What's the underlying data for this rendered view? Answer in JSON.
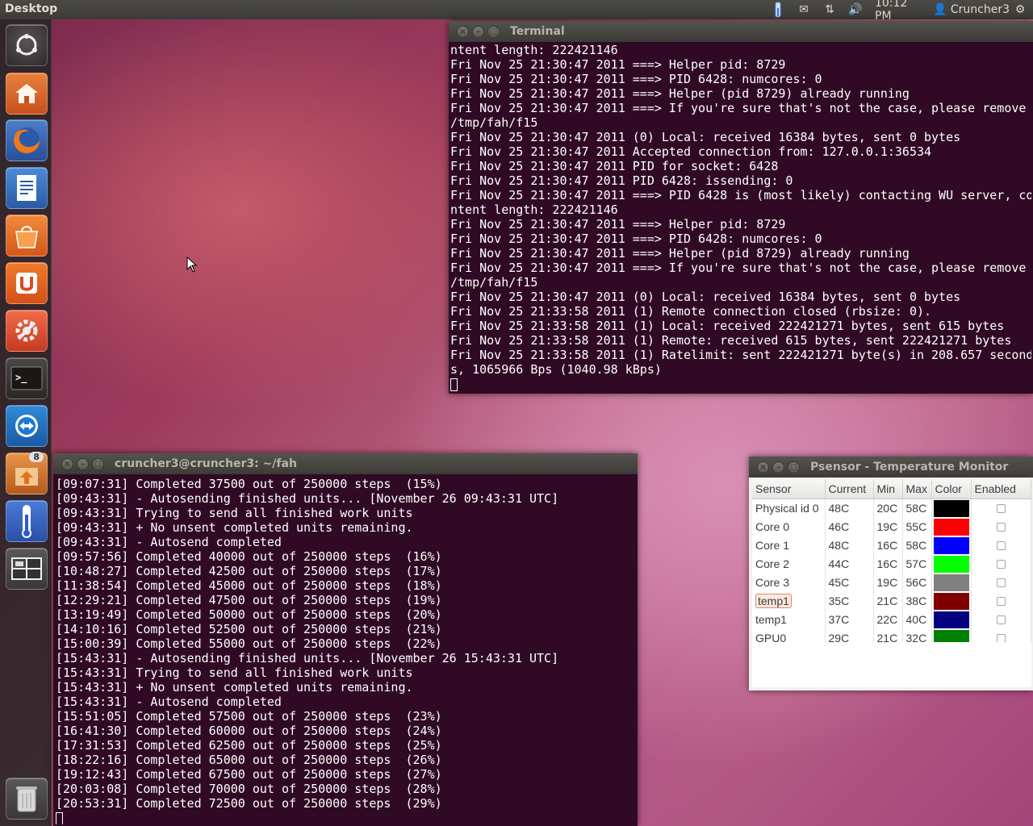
{
  "top_panel": {
    "title": "Desktop",
    "clock": "10:12 PM",
    "user": "Cruncher3"
  },
  "launcher": {
    "items": [
      {
        "name": "dash"
      },
      {
        "name": "home-folder"
      },
      {
        "name": "firefox"
      },
      {
        "name": "libreoffice-writer"
      },
      {
        "name": "ubuntu-software-center"
      },
      {
        "name": "ubuntu-one"
      },
      {
        "name": "system-settings"
      },
      {
        "name": "terminal"
      },
      {
        "name": "teamviewer"
      },
      {
        "name": "archive-manager",
        "badge": "8"
      },
      {
        "name": "psensor"
      },
      {
        "name": "workspace-switcher"
      },
      {
        "name": "trash"
      }
    ]
  },
  "terminal_window": {
    "title": "Terminal",
    "lines": [
      "ntent length: 222421146",
      "Fri Nov 25 21:30:47 2011 ===> Helper pid: 8729",
      "Fri Nov 25 21:30:47 2011 ===> PID 6428: numcores: 0",
      "Fri Nov 25 21:30:47 2011 ===> Helper (pid 8729) already running",
      "Fri Nov 25 21:30:47 2011 ===> If you're sure that's not the case, please remove",
      "/tmp/fah/f15",
      "Fri Nov 25 21:30:47 2011 (0) Local: received 16384 bytes, sent 0 bytes",
      "Fri Nov 25 21:30:47 2011 Accepted connection from: 127.0.0.1:36534",
      "Fri Nov 25 21:30:47 2011 PID for socket: 6428",
      "Fri Nov 25 21:30:47 2011 PID 6428: issending: 0",
      "Fri Nov 25 21:30:47 2011 ===> PID 6428 is (most likely) contacting WU server, co",
      "ntent length: 222421146",
      "Fri Nov 25 21:30:47 2011 ===> Helper pid: 8729",
      "Fri Nov 25 21:30:47 2011 ===> PID 6428: numcores: 0",
      "Fri Nov 25 21:30:47 2011 ===> Helper (pid 8729) already running",
      "Fri Nov 25 21:30:47 2011 ===> If you're sure that's not the case, please remove",
      "/tmp/fah/f15",
      "Fri Nov 25 21:30:47 2011 (0) Local: received 16384 bytes, sent 0 bytes",
      "Fri Nov 25 21:33:58 2011 (1) Remote connection closed (rbsize: 0).",
      "Fri Nov 25 21:33:58 2011 (1) Local: received 222421271 bytes, sent 615 bytes",
      "Fri Nov 25 21:33:58 2011 (1) Remote: received 615 bytes, sent 222421271 bytes",
      "Fri Nov 25 21:33:58 2011 (1) Ratelimit: sent 222421271 byte(s) in 208.657 second",
      "s, 1065966 Bps (1040.98 kBps)"
    ]
  },
  "fah_window": {
    "title": "cruncher3@cruncher3: ~/fah",
    "lines": [
      "[09:07:31] Completed 37500 out of 250000 steps  (15%)",
      "[09:43:31] - Autosending finished units... [November 26 09:43:31 UTC]",
      "[09:43:31] Trying to send all finished work units",
      "[09:43:31] + No unsent completed units remaining.",
      "[09:43:31] - Autosend completed",
      "[09:57:56] Completed 40000 out of 250000 steps  (16%)",
      "[10:48:27] Completed 42500 out of 250000 steps  (17%)",
      "[11:38:54] Completed 45000 out of 250000 steps  (18%)",
      "[12:29:21] Completed 47500 out of 250000 steps  (19%)",
      "[13:19:49] Completed 50000 out of 250000 steps  (20%)",
      "[14:10:16] Completed 52500 out of 250000 steps  (21%)",
      "[15:00:39] Completed 55000 out of 250000 steps  (22%)",
      "[15:43:31] - Autosending finished units... [November 26 15:43:31 UTC]",
      "[15:43:31] Trying to send all finished work units",
      "[15:43:31] + No unsent completed units remaining.",
      "[15:43:31] - Autosend completed",
      "[15:51:05] Completed 57500 out of 250000 steps  (23%)",
      "[16:41:30] Completed 60000 out of 250000 steps  (24%)",
      "[17:31:53] Completed 62500 out of 250000 steps  (25%)",
      "[18:22:16] Completed 65000 out of 250000 steps  (26%)",
      "[19:12:43] Completed 67500 out of 250000 steps  (27%)",
      "[20:03:08] Completed 70000 out of 250000 steps  (28%)",
      "[20:53:31] Completed 72500 out of 250000 steps  (29%)"
    ]
  },
  "psensor_window": {
    "title": "Psensor - Temperature Monitor",
    "columns": [
      "Sensor",
      "Current",
      "Min",
      "Max",
      "Color",
      "Enabled"
    ],
    "rows": [
      {
        "sensor": "Physical id 0",
        "current": "48C",
        "min": "20C",
        "max": "58C",
        "color": "#000000",
        "enabled": false
      },
      {
        "sensor": "Core 0",
        "current": "46C",
        "min": "19C",
        "max": "55C",
        "color": "#ff0000",
        "enabled": false
      },
      {
        "sensor": "Core 1",
        "current": "48C",
        "min": "16C",
        "max": "58C",
        "color": "#0000ff",
        "enabled": false
      },
      {
        "sensor": "Core 2",
        "current": "44C",
        "min": "16C",
        "max": "57C",
        "color": "#00ff00",
        "enabled": false
      },
      {
        "sensor": "Core 3",
        "current": "45C",
        "min": "19C",
        "max": "56C",
        "color": "#808080",
        "enabled": false
      },
      {
        "sensor": "temp1",
        "current": "35C",
        "min": "21C",
        "max": "38C",
        "color": "#800000",
        "enabled": false,
        "selected": true
      },
      {
        "sensor": "temp1",
        "current": "37C",
        "min": "22C",
        "max": "40C",
        "color": "#000080",
        "enabled": false
      },
      {
        "sensor": "GPU0",
        "current": "29C",
        "min": "21C",
        "max": "32C",
        "color": "#008000",
        "enabled": false
      }
    ]
  }
}
